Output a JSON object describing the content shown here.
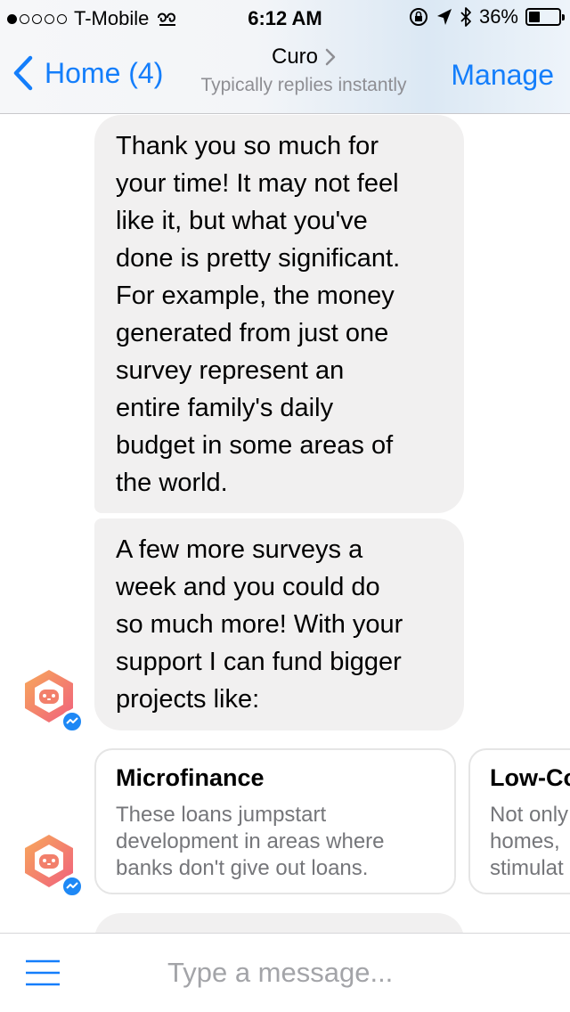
{
  "status_bar": {
    "carrier": "T-Mobile",
    "time": "6:12 AM",
    "battery_percent_text": "36%",
    "battery_level": 0.36,
    "signal_bars_filled": 1,
    "signal_bars_total": 5
  },
  "nav": {
    "back_label": "Home (4)",
    "title": "Curo",
    "subtitle": "Typically replies instantly",
    "manage_label": "Manage",
    "accent_color": "#147efb"
  },
  "messages": [
    {
      "lines": [
        "Thank you so much for",
        "your time! It may not feel",
        "like it, but what you've",
        "done is pretty significant.",
        "For example, the money",
        "generated from just one",
        "survey represent an",
        "entire family's daily",
        "budget in some areas of",
        "the world."
      ]
    },
    {
      "lines": [
        "A few more surveys a",
        "week and you could do",
        "so much more! With your",
        "support I can fund bigger",
        "projects like:"
      ]
    }
  ],
  "cards": [
    {
      "title": "Microfinance",
      "description": "These loans jumpstart development in areas where banks don't give out loans."
    },
    {
      "title": "Low-Co",
      "description_lines": [
        "Not only",
        "homes,",
        "stimulat"
      ]
    }
  ],
  "composer": {
    "placeholder": "Type a message..."
  },
  "icons": {
    "back": "chevron-left-icon",
    "title_chevron": "chevron-right-icon",
    "avatar": "curo-bot-avatar-icon",
    "badge": "messenger-badge-icon",
    "menu": "hamburger-menu-icon"
  }
}
